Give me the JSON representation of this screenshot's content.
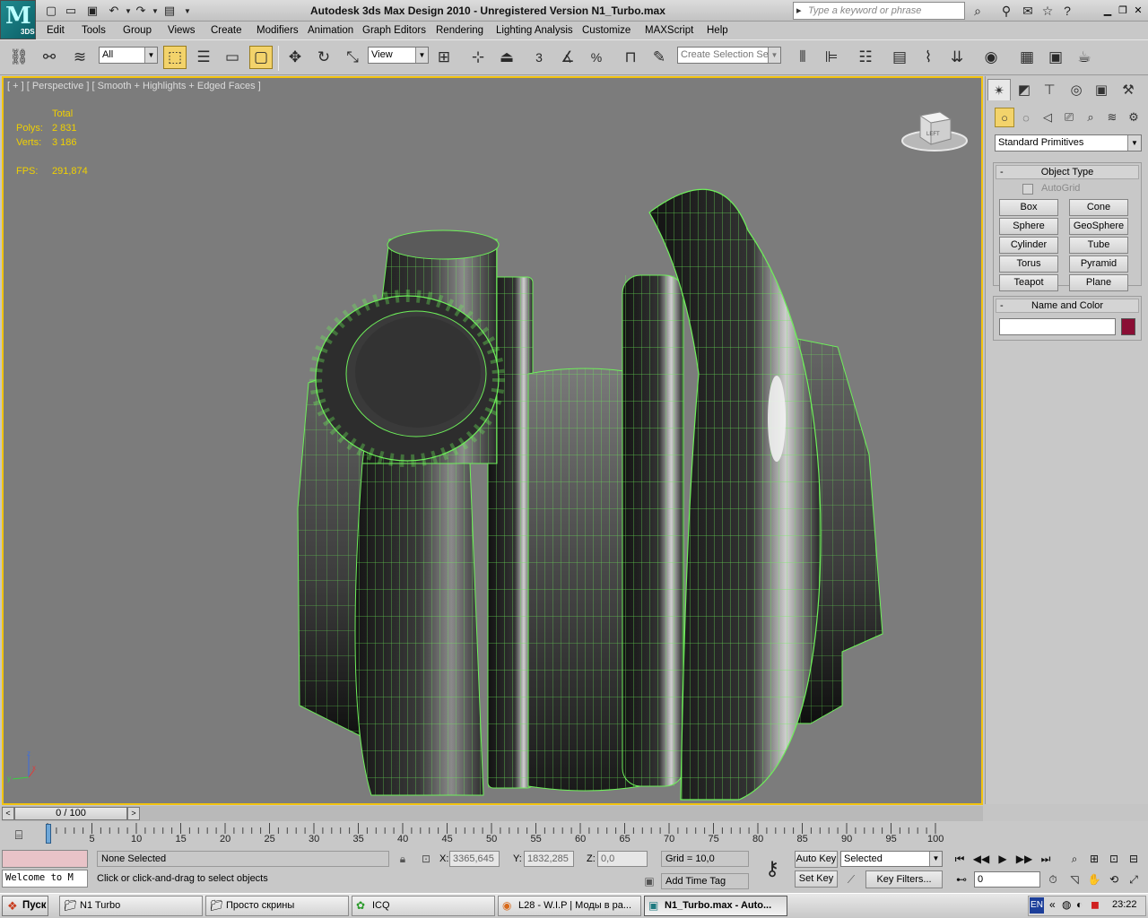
{
  "window": {
    "app_badge": "3DS",
    "title": "Autodesk 3ds Max Design 2010 - Unregistered Version    N1_Turbo.max",
    "search_placeholder": "Type a keyword or phrase"
  },
  "menu": [
    "Edit",
    "Tools",
    "Group",
    "Views",
    "Create",
    "Modifiers",
    "Animation",
    "Graph Editors",
    "Rendering",
    "Lighting Analysis",
    "Customize",
    "MAXScript",
    "Help"
  ],
  "toolbar": {
    "selection_filter": "All",
    "reference_coord": "View",
    "named_selection_placeholder": "Create Selection Se",
    "snap_toggle_label": "3",
    "percent_snap_label": "%"
  },
  "viewport": {
    "label": "[ + ] [ Perspective ] [ Smooth + Highlights + Edged Faces ]",
    "stats": {
      "total_label": "Total",
      "polys_label": "Polys:",
      "polys_value": "2 831",
      "verts_label": "Verts:",
      "verts_value": "3 186",
      "fps_label": "FPS:",
      "fps_value": "291,874"
    },
    "viewcube_label": "LEFT",
    "axis": {
      "z": "z",
      "y": "y",
      "x": "x"
    }
  },
  "command_panel": {
    "primitive_type": "Standard Primitives",
    "object_type_title": "Object Type",
    "autogrid_label": "AutoGrid",
    "primitives": [
      "Box",
      "Cone",
      "Sphere",
      "GeoSphere",
      "Cylinder",
      "Tube",
      "Torus",
      "Pyramid",
      "Teapot",
      "Plane"
    ],
    "name_color_title": "Name and Color",
    "rollout_minus": "-",
    "color": "#8a0d34"
  },
  "timeline": {
    "slider_label": "0 / 100",
    "ticks": [
      "0",
      "5",
      "10",
      "15",
      "20",
      "25",
      "30",
      "35",
      "40",
      "45",
      "50",
      "55",
      "60",
      "65",
      "70",
      "75",
      "80",
      "85",
      "90",
      "95",
      "100"
    ]
  },
  "status": {
    "listener_output": "Welcome to M",
    "selection_status": "None Selected",
    "prompt": "Click or click-and-drag to select objects",
    "x_label": "X:",
    "x_value": "3365,645",
    "y_label": "Y:",
    "y_value": "1832,285",
    "z_label": "Z:",
    "z_value": "0,0",
    "grid": "Grid = 10,0",
    "add_time_tag": "Add Time Tag",
    "auto_key": "Auto Key",
    "set_key": "Set Key",
    "selected_mode": "Selected",
    "key_filters": "Key Filters...",
    "current_frame": "0"
  },
  "taskbar": {
    "start": "Пуск",
    "tasks": [
      "N1 Turbo",
      "Просто скрины",
      "ICQ",
      "L28 - W.I.P | Моды в ра...",
      "N1_Turbo.max - Auto..."
    ],
    "language": "EN",
    "clock": "23:22"
  },
  "colors": {
    "wire": "#6ef05a",
    "stat_text": "#f0d000",
    "viewport_bg": "#7c7c7c",
    "active_border": "#f2c30f"
  }
}
